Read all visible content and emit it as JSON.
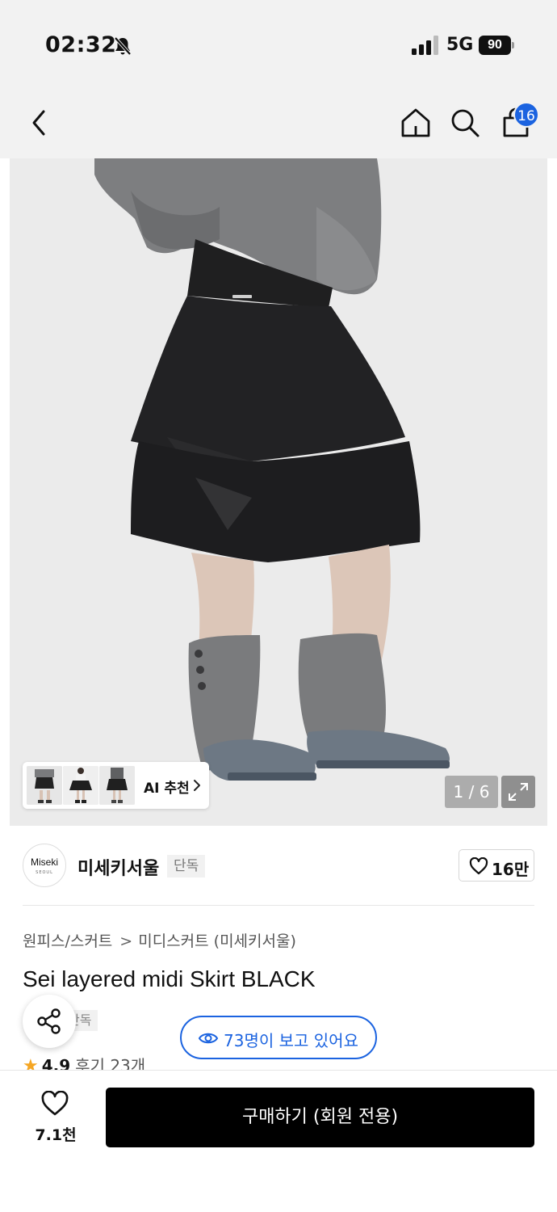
{
  "status_bar": {
    "time": "02:32",
    "network": "5G",
    "battery": "90"
  },
  "header": {
    "cart_count": "16"
  },
  "gallery": {
    "ai_label": "AI 추천",
    "page_indicator": "1 / 6"
  },
  "brand": {
    "logo_text": "Miseki",
    "logo_subtext": "SEOUL",
    "name": "미세키서울",
    "tag": "단독",
    "likes": "16만"
  },
  "product": {
    "breadcrumb": [
      "원피스/스커트",
      "미디스커트 (미세키서울)"
    ],
    "breadcrumb_sep": ">",
    "title": "Sei layered midi Skirt BLACK",
    "exclusive_tag": "단독",
    "viewers": "73명이 보고 있어요",
    "rating": "4.9",
    "reviews": "후기 23개"
  },
  "bottom_bar": {
    "wishlist_count": "7.1천",
    "buy_label": "구매하기 (회원 전용)"
  },
  "colors": {
    "accent": "#1b63e0",
    "star": "#f5a623",
    "buy_button": "#000000"
  }
}
